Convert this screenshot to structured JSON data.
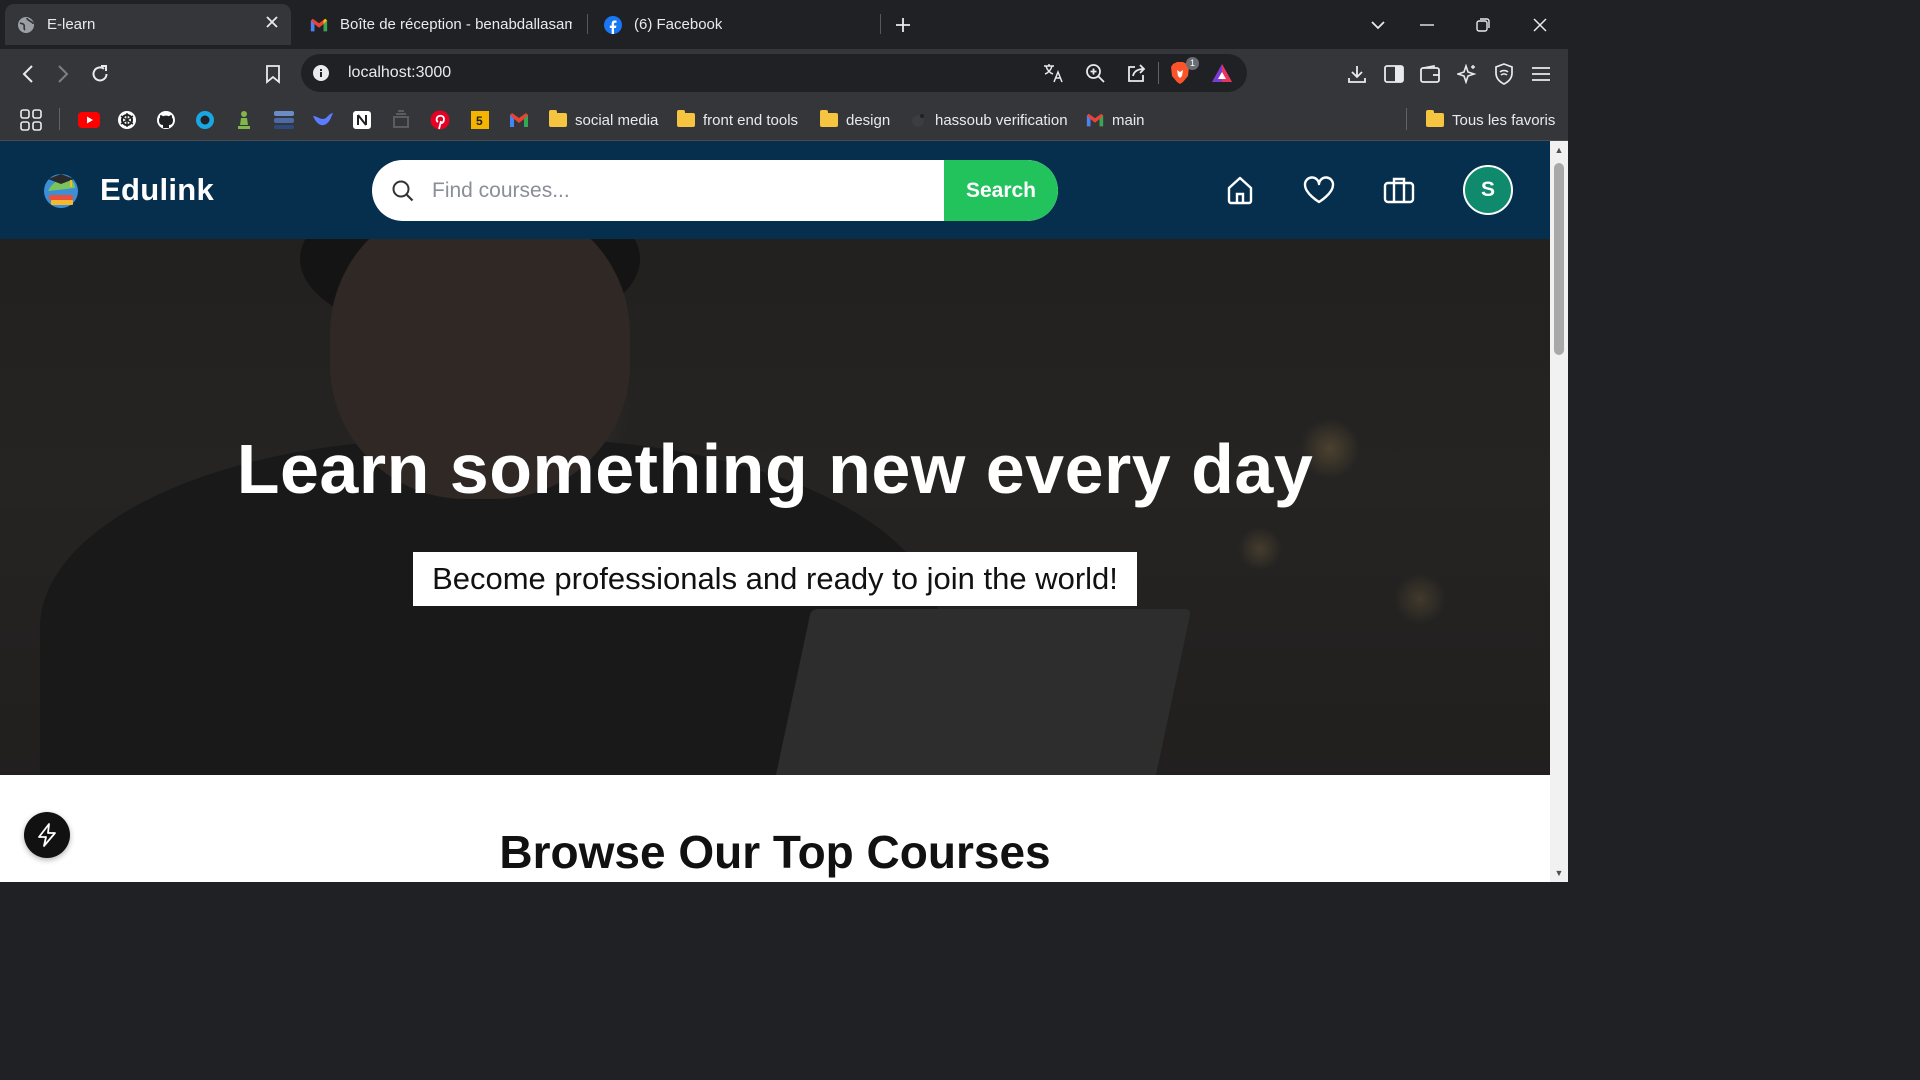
{
  "tabs": [
    {
      "label": "E-learn",
      "icon": "globe-icon",
      "active": true
    },
    {
      "label": "Boîte de réception - benabdallasam",
      "icon": "gmail-icon",
      "active": false
    },
    {
      "label": "(6) Facebook",
      "icon": "facebook-icon",
      "active": false
    }
  ],
  "address_bar": {
    "url": "localhost:3000"
  },
  "brave_shield_count": "1",
  "bookmarks": [
    {
      "label": "social media"
    },
    {
      "label": "front end tools"
    },
    {
      "label": "design"
    },
    {
      "label": "hassoub verification"
    },
    {
      "label": "main"
    }
  ],
  "bookmarks_right": "Tous les favoris",
  "site": {
    "brand": "Edulink",
    "search_placeholder": "Find courses...",
    "search_button": "Search",
    "avatar_initial": "S",
    "hero_title": "Learn something new every day",
    "hero_subtitle": "Become professionals and ready to join the world!",
    "section_title": "Browse Our Top Courses"
  },
  "colors": {
    "navbar": "#062f4d",
    "accent_green": "#22c25d",
    "avatar": "#0f8a6d"
  }
}
